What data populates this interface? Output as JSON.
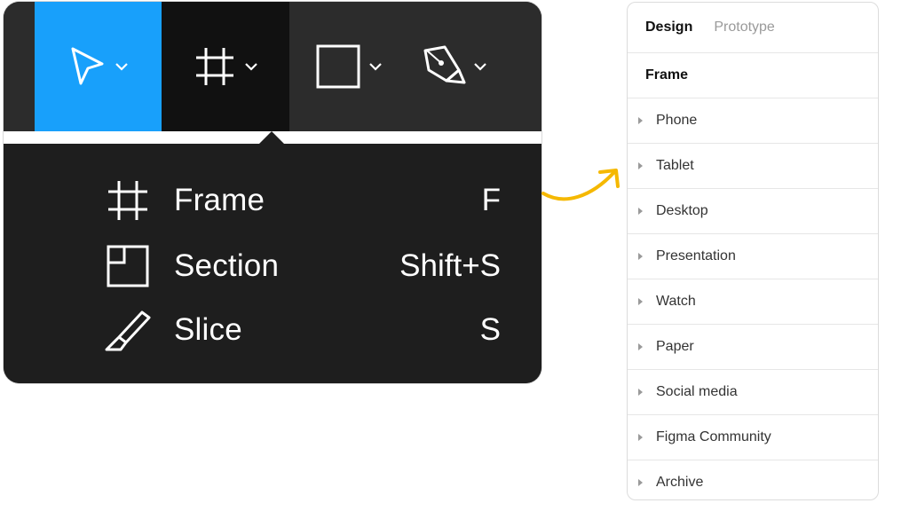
{
  "toolbar": {
    "tools": [
      {
        "name": "move",
        "icon": "move-arrow-icon",
        "active": true
      },
      {
        "name": "frame",
        "icon": "frame-icon",
        "open": true
      },
      {
        "name": "shape",
        "icon": "rectangle-icon"
      },
      {
        "name": "pen",
        "icon": "pen-icon"
      }
    ]
  },
  "menu": {
    "items": [
      {
        "label": "Frame",
        "shortcut": "F",
        "icon": "frame-icon"
      },
      {
        "label": "Section",
        "shortcut": "Shift+S",
        "icon": "section-icon"
      },
      {
        "label": "Slice",
        "shortcut": "S",
        "icon": "slice-icon"
      }
    ]
  },
  "panel": {
    "tabs": [
      "Design",
      "Prototype"
    ],
    "section_title": "Frame",
    "rows": [
      "Phone",
      "Tablet",
      "Desktop",
      "Presentation",
      "Watch",
      "Paper",
      "Social media",
      "Figma Community",
      "Archive"
    ]
  },
  "colors": {
    "accent": "#18a0fb",
    "toolbar_bg": "#2c2c2c",
    "menu_bg": "#1e1e1e",
    "arrow": "#f5b800"
  }
}
